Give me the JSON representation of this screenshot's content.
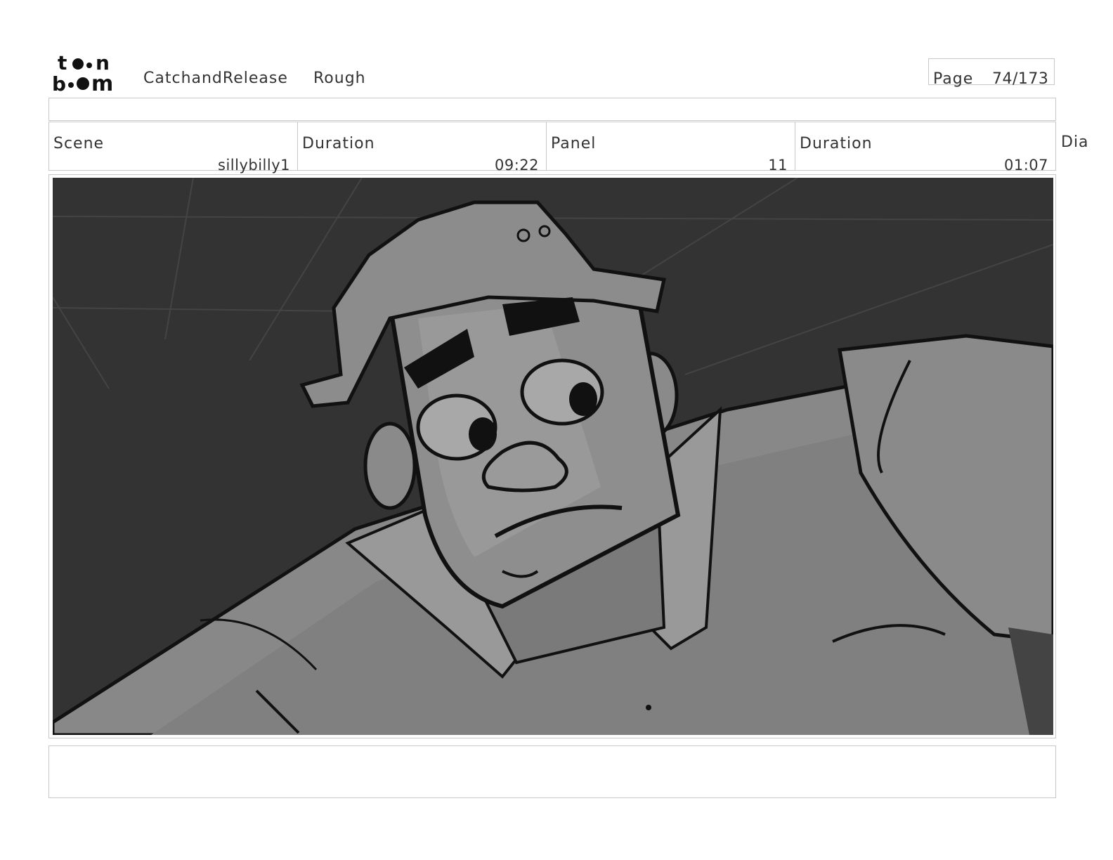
{
  "header": {
    "logo_text": "toonboom",
    "project_name": "CatchandRelease",
    "stage": "Rough",
    "page_label": "Page",
    "page_value": "74/173"
  },
  "info": {
    "scene_label": "Scene",
    "scene_value": "sillybilly1",
    "scene_duration_label": "Duration",
    "scene_duration_value": "09:22",
    "panel_label": "Panel",
    "panel_value": "11",
    "panel_duration_label": "Duration",
    "panel_duration_value": "01:07",
    "dialogue_label": "Dia"
  },
  "panel": {
    "icon": "storyboard-panel-image"
  }
}
